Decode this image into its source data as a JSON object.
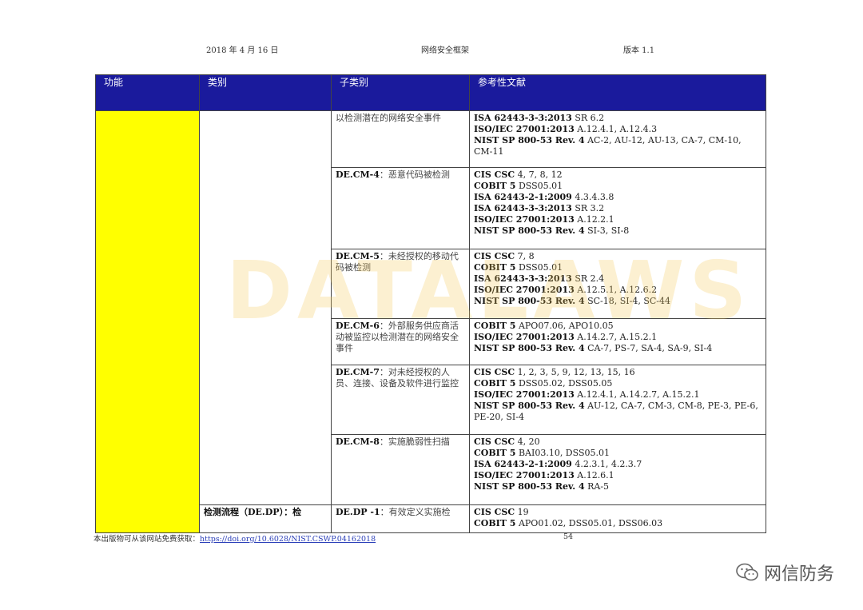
{
  "header": {
    "date": "2018 年 4 月 16 日",
    "title": "网络安全框架",
    "version": "版本 1.1"
  },
  "table": {
    "columns": [
      "功能",
      "类别",
      "子类别",
      "参考性文献"
    ],
    "rows": [
      {
        "category": "",
        "sub_code": "",
        "sub_text": "以检测潜在的网络安全事件",
        "refs": [
          {
            "std": "ISA 62443-3-3:2013",
            "val": "SR 6.2"
          },
          {
            "std": "ISO/IEC 27001:2013",
            "val": "A.12.4.1, A.12.4.3"
          },
          {
            "std": "NIST SP 800-53 Rev. 4",
            "val": "AC-2, AU-12, AU-13, CA-7, CM-10, CM-11"
          }
        ]
      },
      {
        "category": "",
        "sub_code": "DE.CM-4",
        "sub_text": "：恶意代码被检测",
        "refs": [
          {
            "std": "CIS CSC",
            "val": "4, 7, 8, 12"
          },
          {
            "std": "COBIT 5",
            "val": "DSS05.01"
          },
          {
            "std": "ISA 62443-2-1:2009",
            "val": "4.3.4.3.8"
          },
          {
            "std": "ISA 62443-3-3:2013",
            "val": "SR 3.2"
          },
          {
            "std": "ISO/IEC 27001:2013",
            "val": "A.12.2.1"
          },
          {
            "std": "NIST SP 800-53 Rev. 4",
            "val": "SI-3, SI-8"
          }
        ]
      },
      {
        "category": "",
        "sub_code": "DE.CM-5",
        "sub_text": "：未经授权的移动代码被检测",
        "refs": [
          {
            "std": "CIS CSC",
            "val": "7, 8"
          },
          {
            "std": "COBIT 5",
            "val": "DSS05.01"
          },
          {
            "std": "ISA 62443-3-3:2013",
            "val": "SR 2.4"
          },
          {
            "std": "ISO/IEC 27001:2013",
            "val": "A.12.5.1, A.12.6.2"
          },
          {
            "std": "NIST SP 800-53 Rev. 4",
            "val": "SC-18, SI-4, SC-44"
          }
        ]
      },
      {
        "category": "",
        "sub_code": "DE.CM-6",
        "sub_text": "：外部服务供应商活动被监控以检测潜在的网络安全事件",
        "refs": [
          {
            "std": "COBIT 5",
            "val": "APO07.06, APO10.05"
          },
          {
            "std": "ISO/IEC 27001:2013",
            "val": "A.14.2.7, A.15.2.1"
          },
          {
            "std": "NIST SP 800-53 Rev. 4",
            "val": "CA-7, PS-7, SA-4, SA-9, SI-4"
          }
        ]
      },
      {
        "category": "",
        "sub_code": "DE.CM-7",
        "sub_text": "：对未经授权的人员、连接、设备及软件进行监控",
        "refs": [
          {
            "std": "CIS CSC",
            "val": "1, 2, 3, 5, 9, 12, 13, 15, 16"
          },
          {
            "std": "COBIT 5",
            "val": "DSS05.02, DSS05.05"
          },
          {
            "std": "ISO/IEC 27001:2013",
            "val": "A.12.4.1, A.14.2.7, A.15.2.1"
          },
          {
            "std": "NIST SP 800-53 Rev. 4",
            "val": "AU-12, CA-7, CM-3, CM-8, PE-3, PE-6, PE-20, SI-4"
          }
        ]
      },
      {
        "category": "",
        "sub_code": "DE.CM-8",
        "sub_text": "：实施脆弱性扫描",
        "refs": [
          {
            "std": "CIS CSC",
            "val": "4, 20"
          },
          {
            "std": "COBIT 5",
            "val": "BAI03.10, DSS05.01"
          },
          {
            "std": "ISA 62443-2-1:2009",
            "val": "4.2.3.1, 4.2.3.7"
          },
          {
            "std": "ISO/IEC 27001:2013",
            "val": "A.12.6.1"
          },
          {
            "std": "NIST SP 800-53 Rev. 4",
            "val": "RA-5"
          }
        ]
      },
      {
        "category": "检测流程（DE.DP）：检",
        "sub_code": "DE.DP -1",
        "sub_text": "：有效定义实施检",
        "refs": [
          {
            "std": "CIS CSC",
            "val": "19"
          },
          {
            "std": "COBIT 5",
            "val": "APO01.02, DSS05.01, DSS06.03"
          }
        ]
      }
    ]
  },
  "footer": {
    "note_prefix": "本出版物可从该网站免费获取：",
    "link": "https://doi.org/10.6028/NIST.CSWP.04162018",
    "page": "54"
  },
  "watermark": "DATALAWS",
  "wechat": {
    "icon": "wechat-icon",
    "account": "网信防务"
  },
  "colors": {
    "header_bg": "#1a1a9c",
    "function_cell": "#ffff00"
  }
}
